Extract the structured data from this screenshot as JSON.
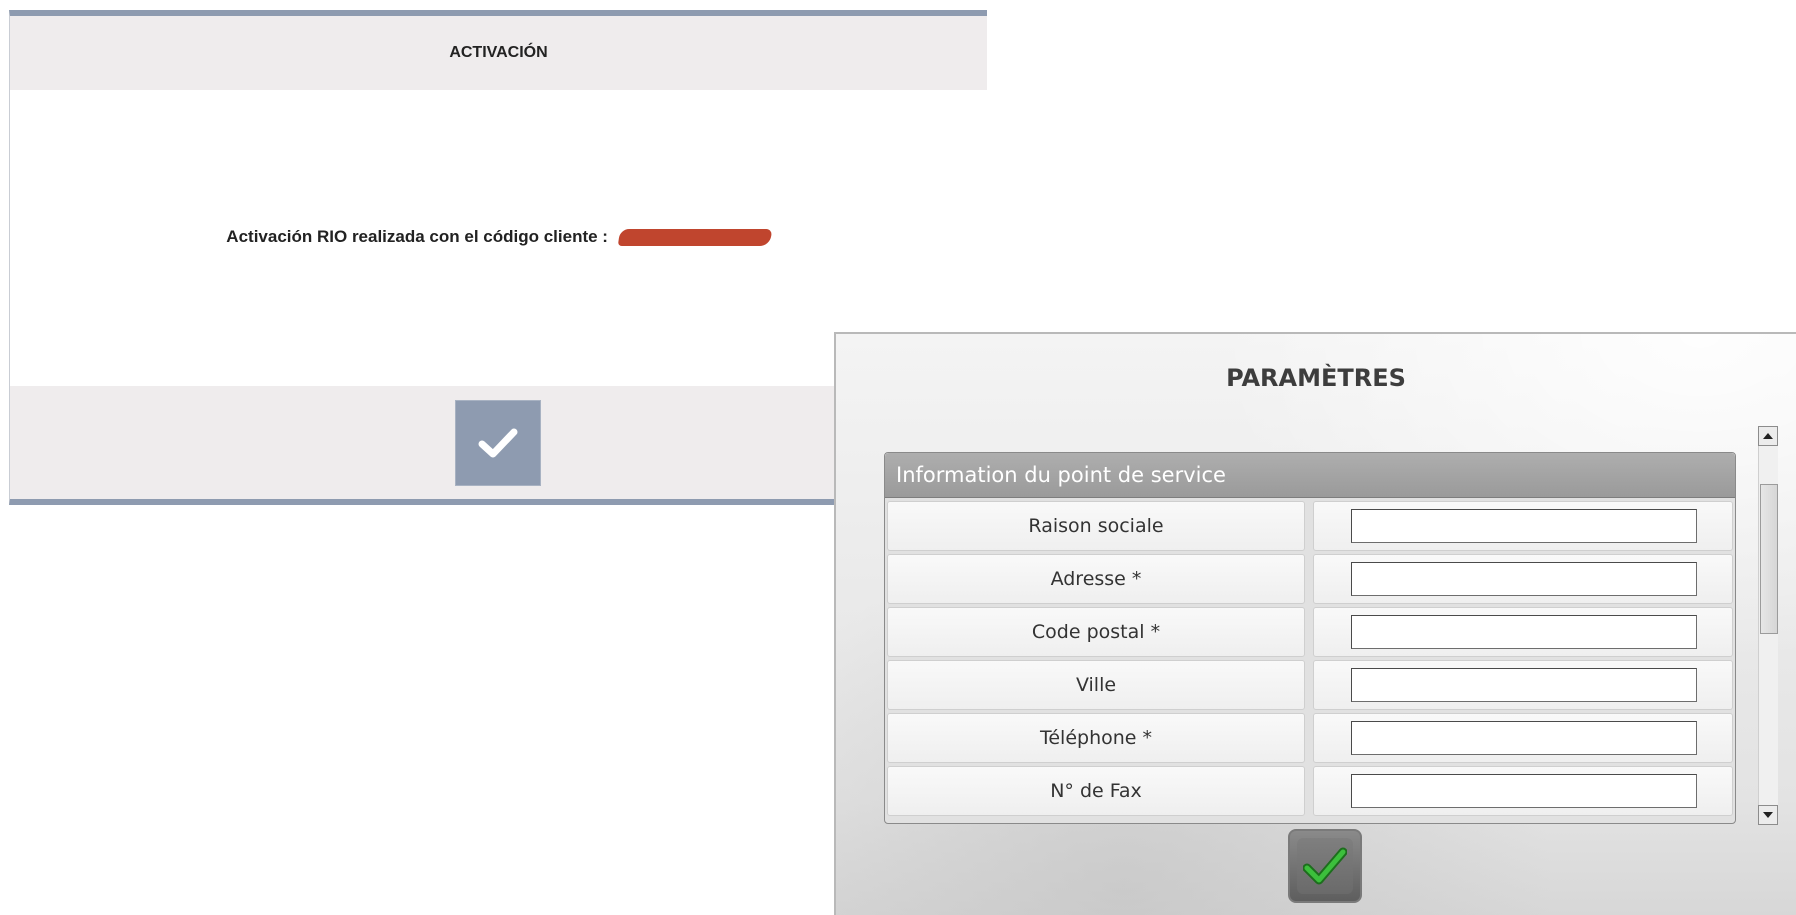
{
  "activation_dialog": {
    "title": "ACTIVACIÓN",
    "message": "Activación RIO realizada con el código cliente :",
    "redacted_value_color": "#c0452e",
    "confirm_icon": "checkmark-icon"
  },
  "parameters_dialog": {
    "title": "PARAMÈTRES",
    "section_title": "Information du point de service",
    "fields": [
      {
        "label": "Raison sociale",
        "value": ""
      },
      {
        "label": "Adresse *",
        "value": ""
      },
      {
        "label": "Code postal *",
        "value": ""
      },
      {
        "label": "Ville",
        "value": ""
      },
      {
        "label": "Téléphone *",
        "value": ""
      },
      {
        "label": "N° de Fax",
        "value": ""
      }
    ],
    "confirm_icon": "green-checkmark-icon"
  },
  "colors": {
    "activation_accent": "#8e9bb0",
    "activation_header_bg": "#efeced",
    "section_header_bg": "#a4a4a4",
    "confirm_check_green": "#2e9a2e"
  }
}
